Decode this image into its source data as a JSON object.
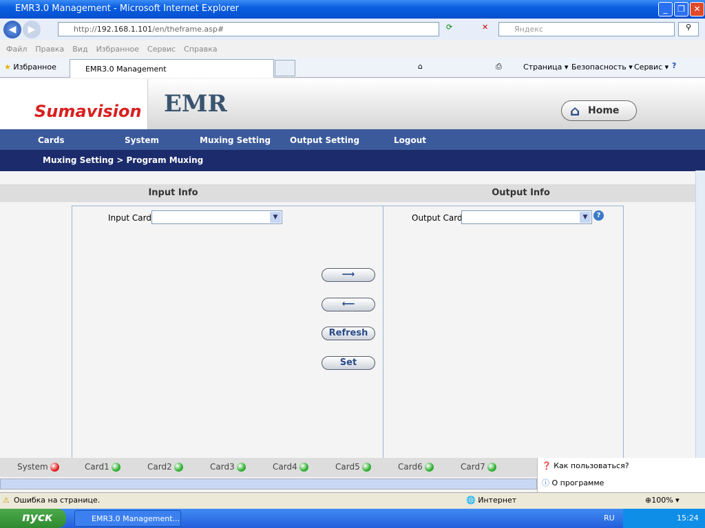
{
  "window": {
    "title": "EMR3.0 Management - Microsoft Internet Explorer"
  },
  "address": {
    "url_prefix": "http://",
    "url_host": "192.168.1.101",
    "url_path": "/en/theframe.asp#",
    "search_placeholder": "Яндекс"
  },
  "menu": [
    "Файл",
    "Правка",
    "Вид",
    "Избранное",
    "Сервис",
    "Справка"
  ],
  "favorites": {
    "label": "Избранное",
    "tab": "EMR3.0 Management",
    "tools": [
      "Страница ▾",
      "Безопасность ▾",
      "Сервис ▾"
    ]
  },
  "header": {
    "logo": "Sumavision",
    "product": "EMR",
    "home": "Home"
  },
  "nav": [
    "Cards",
    "System",
    "Muxing Setting",
    "Output Setting",
    "Logout"
  ],
  "breadcrumb": "Muxing Setting > Program Muxing",
  "input": {
    "title": "Input Info",
    "card_label": "Input Card:",
    "card_value": ""
  },
  "output": {
    "title": "Output Info",
    "card_label": "Output Card:",
    "card_value": ""
  },
  "buttons": {
    "add": "⟶",
    "remove": "⟵",
    "refresh": "Refresh",
    "set": "Set"
  },
  "status_items": [
    {
      "label": "System",
      "color": "#e02020"
    },
    {
      "label": "Card1",
      "color": "#2fae2f"
    },
    {
      "label": "Card2",
      "color": "#2fae2f"
    },
    {
      "label": "Card3",
      "color": "#2fae2f"
    },
    {
      "label": "Card4",
      "color": "#2fae2f"
    },
    {
      "label": "Card5",
      "color": "#2fae2f"
    },
    {
      "label": "Card6",
      "color": "#2fae2f"
    },
    {
      "label": "Card7",
      "color": "#2fae2f"
    }
  ],
  "help": {
    "how": "Как пользоваться?",
    "about": "О программе"
  },
  "statusbar": {
    "error": "Ошибка на странице.",
    "zone": "Интернет",
    "zoom": "100%"
  },
  "taskbar": {
    "start": "пуск",
    "task": "EMR3.0 Management...",
    "lang": "RU",
    "time": "15:24"
  }
}
